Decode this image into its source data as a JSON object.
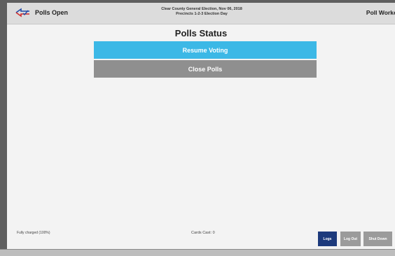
{
  "header": {
    "status_label": "Polls Open",
    "election_title": "Clear County General Election, Nov 06, 2018",
    "election_subtitle": "Precincts 1-2-3 Election Day",
    "role_label": "Poll Worker",
    "brand_icon": "flag-checkmark-icon"
  },
  "main": {
    "title": "Polls Status",
    "resume_label": "Resume Voting",
    "close_label": "Close Polls"
  },
  "footer": {
    "battery_status": "Fully charged (100%)",
    "cards_cast": "Cards Cast: 0",
    "logs_label": "Logs",
    "logout_label": "Log Out",
    "shutdown_label": "Shut Down"
  },
  "colors": {
    "accent": "#3cb8e6",
    "secondary": "#8f8f8f",
    "logs": "#1d3a7c",
    "header_bg": "#dcdcdc"
  }
}
